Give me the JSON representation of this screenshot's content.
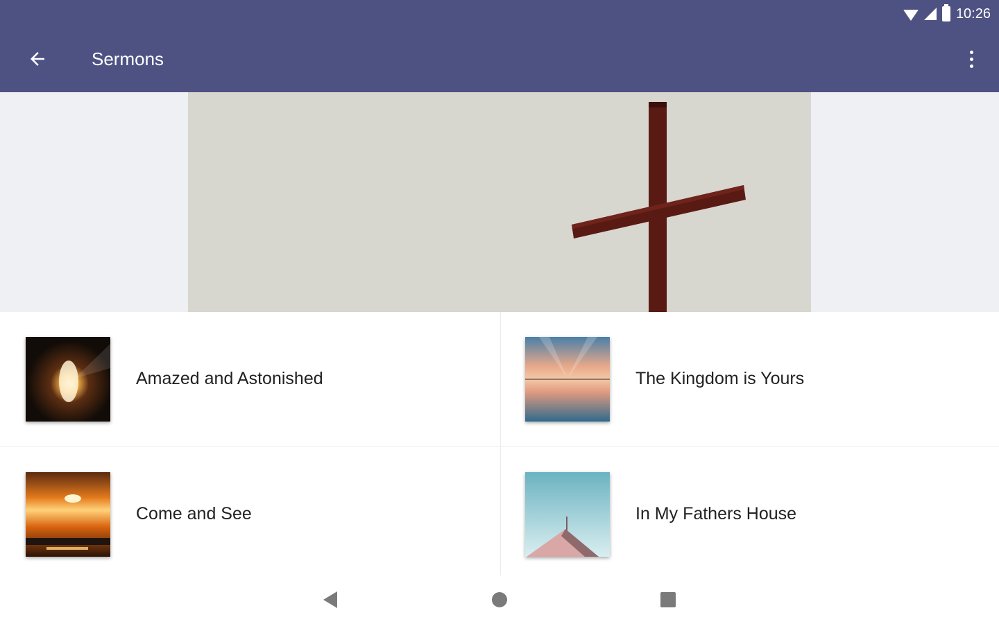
{
  "status_bar": {
    "time": "10:26",
    "icons": [
      "wifi-icon",
      "cell-signal-icon",
      "battery-icon"
    ]
  },
  "toolbar": {
    "title": "Sermons",
    "back_icon": "arrow-left-icon",
    "menu_icon": "more-vert-icon"
  },
  "colors": {
    "app_bar": "#4e5283",
    "hero_background": "#d7d6cf",
    "cross": "#5a1a14"
  },
  "hero": {
    "image": "wooden-cross-against-pale-sky"
  },
  "sermons": [
    {
      "title": "Amazed and Astonished",
      "thumbnail": "light-in-dark-cave-tomb"
    },
    {
      "title": "The Kingdom is Yours",
      "thumbnail": "sunset-reflection-on-water"
    },
    {
      "title": "Come and See",
      "thumbnail": "orange-sunset-over-sea"
    },
    {
      "title": "In My Fathers House",
      "thumbnail": "church-roof-against-blue-sky"
    }
  ],
  "nav_bar": {
    "icons": [
      "nav-back-icon",
      "nav-home-icon",
      "nav-recents-icon"
    ]
  }
}
